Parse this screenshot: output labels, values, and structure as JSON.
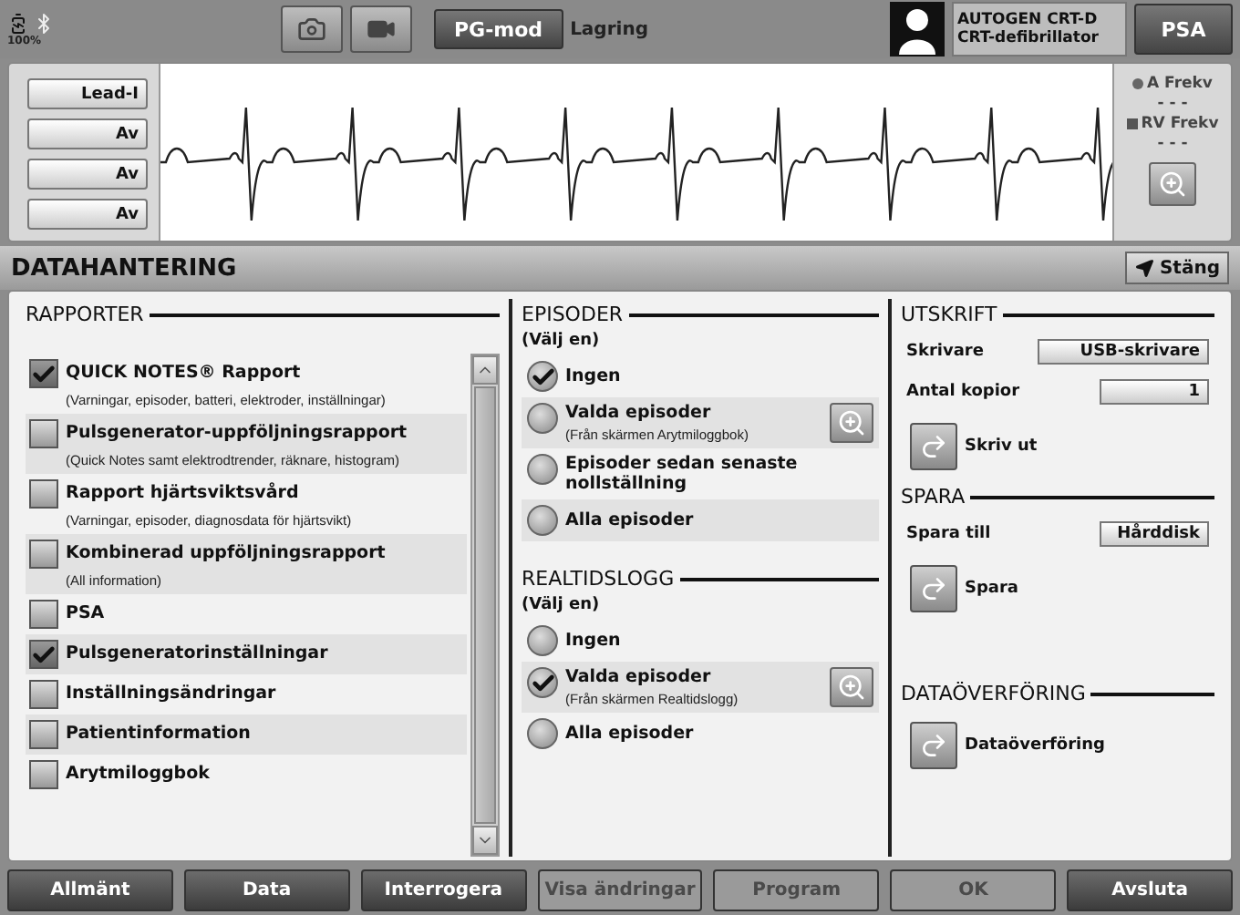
{
  "status": {
    "battery": "100%",
    "mode_button": "PG-mod",
    "storage": "Lagring",
    "device_name": "AUTOGEN CRT-D",
    "device_type": "CRT-defibrillator",
    "psa_button": "PSA"
  },
  "strip": {
    "lead_buttons": [
      "Lead-I",
      "Av",
      "Av",
      "Av"
    ],
    "rates": [
      {
        "label": "A Frekv",
        "value": "- - -",
        "kind": "dot"
      },
      {
        "label": "RV Frekv",
        "value": "- - -",
        "kind": "square"
      }
    ]
  },
  "header": {
    "title": "DATAHANTERING",
    "close_button": "Stäng"
  },
  "rapporter": {
    "title": "RAPPORTER",
    "items": [
      {
        "label": "QUICK NOTES® Rapport",
        "note": "(Varningar, episoder, batteri, elektroder, inställningar)",
        "checked": true
      },
      {
        "label": "Pulsgenerator-uppföljningsrapport",
        "note": "(Quick Notes samt elektrodtrender, räknare, histogram)",
        "checked": false
      },
      {
        "label": "Rapport hjärtsviktsvård",
        "note": "(Varningar, episoder, diagnosdata för hjärtsvikt)",
        "checked": false
      },
      {
        "label": "Kombinerad uppföljningsrapport",
        "note": "(All information)",
        "checked": false
      },
      {
        "label": "PSA",
        "checked": false
      },
      {
        "label": "Pulsgeneratorinställningar",
        "checked": true
      },
      {
        "label": "Inställningsändringar",
        "checked": false
      },
      {
        "label": "Patientinformation",
        "checked": false
      },
      {
        "label": "Arytmiloggbok",
        "checked": false
      }
    ]
  },
  "episoder": {
    "title": "EPISODER",
    "hint": "(Välj en)",
    "options": [
      {
        "label": "Ingen",
        "selected": true
      },
      {
        "label": "Valda episoder",
        "note": "(Från skärmen Arytmiloggbok)",
        "zoom": true,
        "selected": false
      },
      {
        "label": "Episoder sedan senaste nollställning",
        "selected": false
      },
      {
        "label": "Alla episoder",
        "selected": false
      }
    ]
  },
  "realtidslogg": {
    "title": "REALTIDSLOGG",
    "hint": "(Välj en)",
    "options": [
      {
        "label": "Ingen",
        "selected": false
      },
      {
        "label": "Valda episoder",
        "note": "(Från skärmen Realtidslogg)",
        "zoom": true,
        "selected": true
      },
      {
        "label": "Alla episoder",
        "selected": false
      }
    ]
  },
  "utskrift": {
    "title": "UTSKRIFT",
    "fields": [
      {
        "label": "Skrivare",
        "value": "USB-skrivare",
        "wide": true
      },
      {
        "label": "Antal kopior",
        "value": "1",
        "wide": false
      }
    ],
    "action": "Skriv ut"
  },
  "spara": {
    "title": "SPARA",
    "fields": [
      {
        "label": "Spara till",
        "value": "Hårddisk",
        "wide": false
      }
    ],
    "action": "Spara"
  },
  "dataoverforing": {
    "title": "DATAÖVERFÖRING",
    "action": "Dataöverföring"
  },
  "bottom_buttons": [
    {
      "label": "Allmänt",
      "disabled": false
    },
    {
      "label": "Data",
      "disabled": false
    },
    {
      "label": "Interrogera",
      "disabled": false
    },
    {
      "label": "Visa ändringar",
      "disabled": true
    },
    {
      "label": "Program",
      "disabled": true
    },
    {
      "label": "OK",
      "disabled": true
    },
    {
      "label": "Avsluta",
      "disabled": false
    }
  ]
}
